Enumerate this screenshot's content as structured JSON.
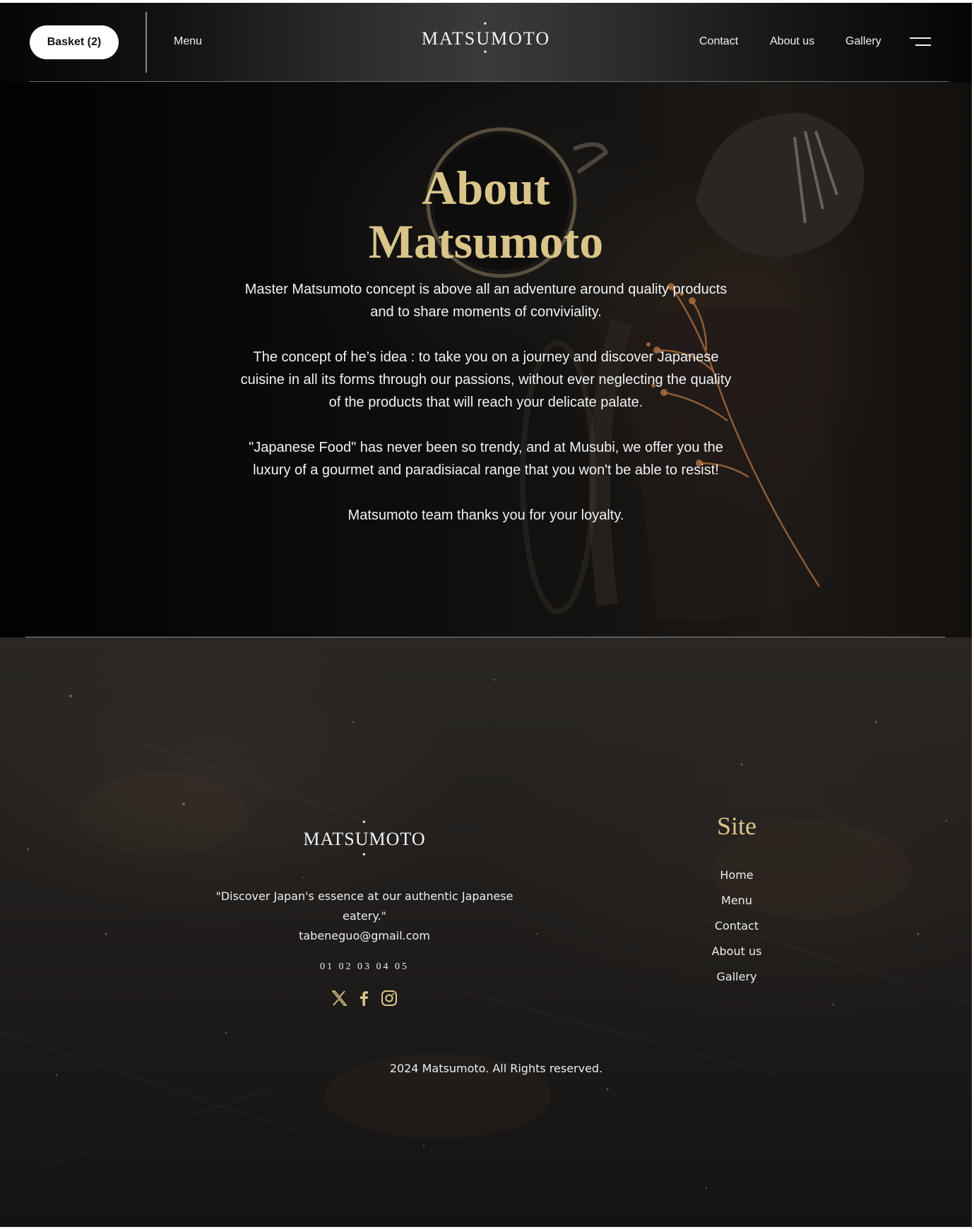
{
  "header": {
    "basket_label": "Basket (2)",
    "menu_label": "Menu",
    "logo": "MATSUMOTO",
    "logo_dot": "•",
    "nav": [
      "Contact",
      "About us",
      "Gallery"
    ]
  },
  "hero": {
    "title_line1": "About",
    "title_line2": "Matsumoto",
    "paragraphs": [
      "Master Matsumoto concept is above all an adventure around quality products and to share moments of conviviality.",
      "The concept of he’s idea : to take you on a journey and discover Japanese cuisine in all its forms through our passions, without ever neglecting the quality of the products that will reach your delicate palate.",
      "\"Japanese Food\" has never been so trendy, and at Musubi, we offer you the luxury of a gourmet and paradisiacal range that you won't be able to resist!",
      "Matsumoto team thanks you for your loyalty."
    ]
  },
  "footer": {
    "logo": "MATSUMOTO",
    "logo_dot": "•",
    "tagline": "\"Discover Japan's essence at our authentic Japanese eatery.\"",
    "email": "tabeneguo@gmail.com",
    "phone": "01 02 03 04 05",
    "social_icons": [
      "x-icon",
      "facebook-icon",
      "instagram-icon"
    ],
    "site_heading": "Site",
    "site_links": [
      "Home",
      "Menu",
      "Contact",
      "About us",
      "Gallery"
    ],
    "copyright": "2024 Matsumoto. All Rights reserved."
  },
  "colors": {
    "gold_accent": "#d9c48a",
    "header_bg": "#3a3a3a",
    "page_bg": "#0d0c0c",
    "text": "#f2f2f2"
  }
}
